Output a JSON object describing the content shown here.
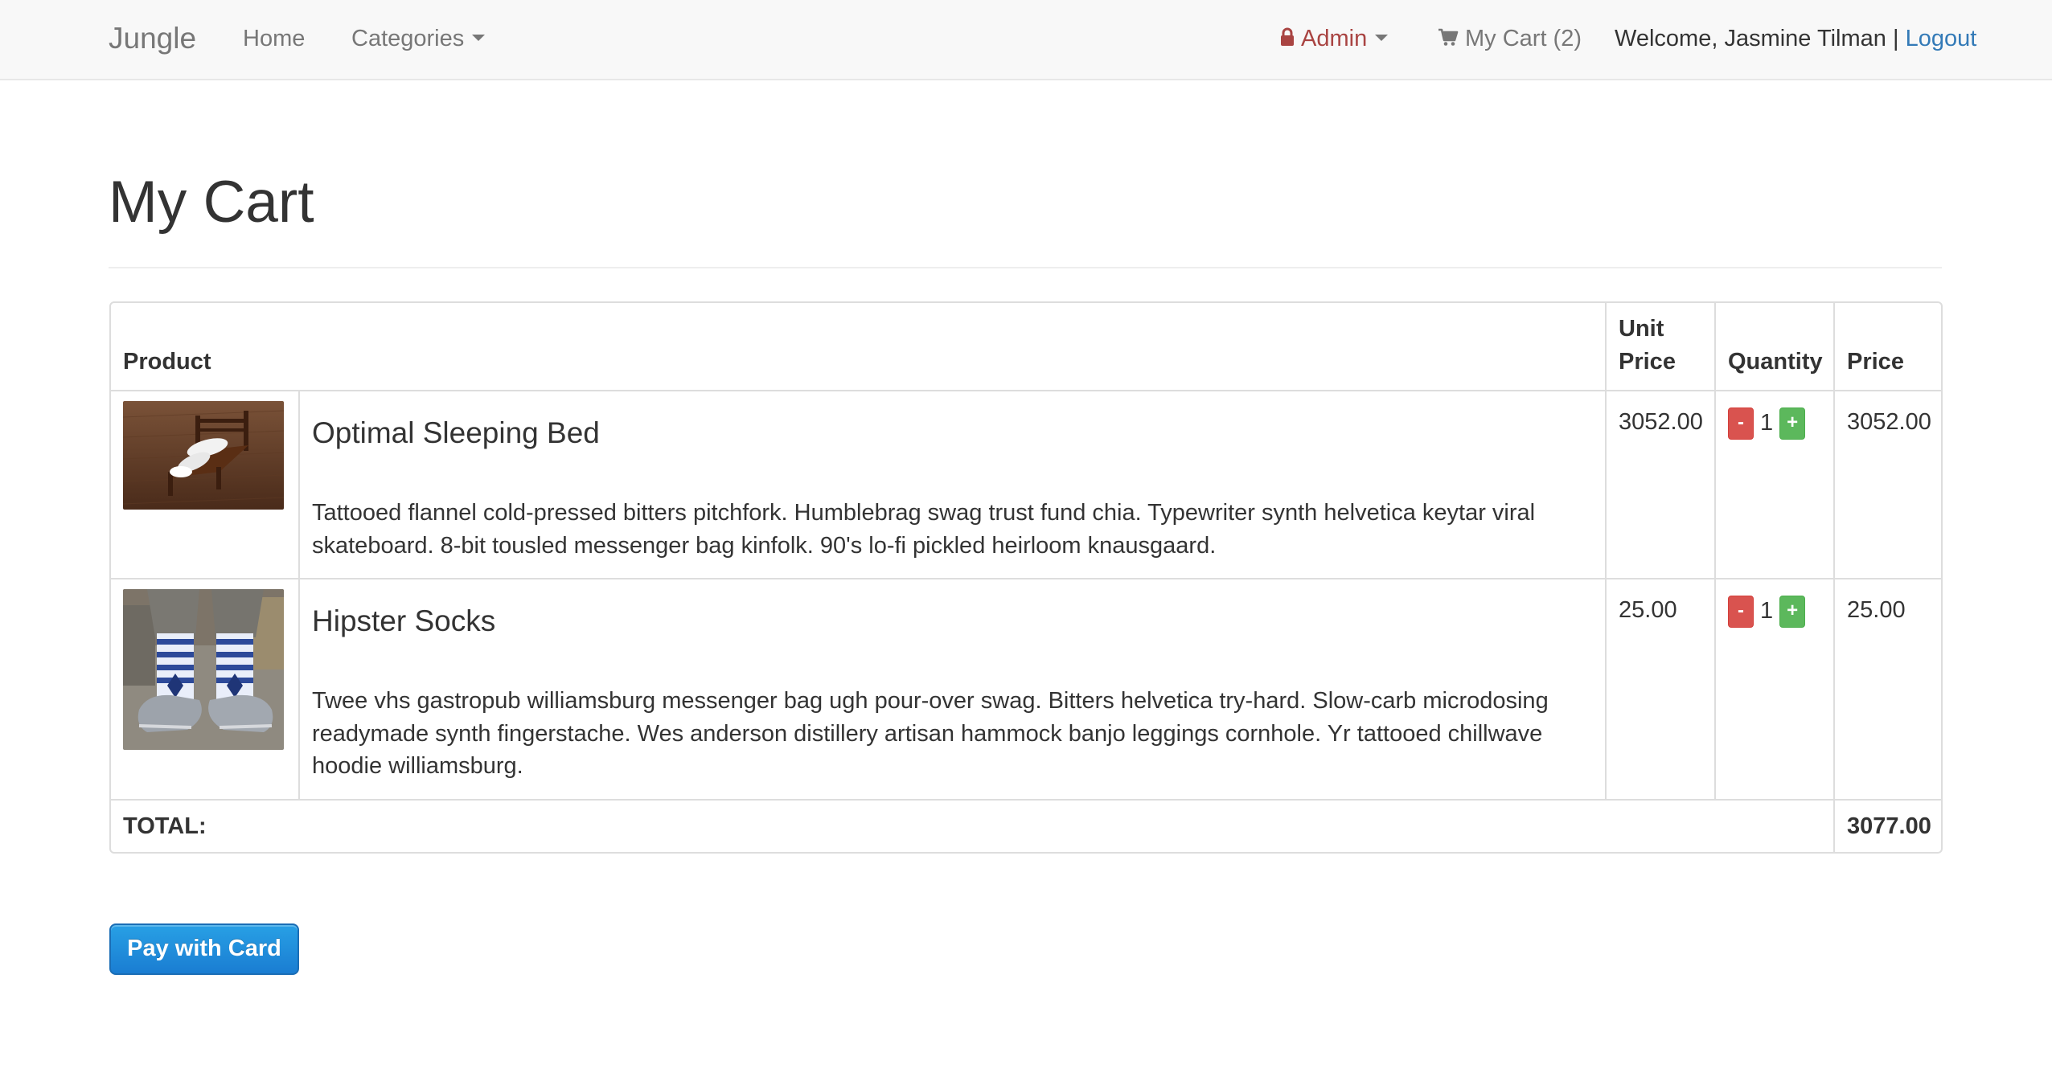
{
  "navbar": {
    "brand": "Jungle",
    "home": "Home",
    "categories": "Categories",
    "admin": "Admin",
    "cart": "My Cart (2)",
    "welcome": "Welcome, Jasmine Tilman",
    "separator": " | ",
    "logout": "Logout"
  },
  "icons": {
    "lock": "lock-icon",
    "cart": "shopping-cart-icon",
    "caret": "caret-down-icon"
  },
  "colors": {
    "admin": "#a94442",
    "link": "#337ab7",
    "qty_minus": "#d9534f",
    "qty_plus": "#5cb85c",
    "pay_button": "#1a7dd2"
  },
  "page": {
    "title": "My Cart"
  },
  "table": {
    "headers": {
      "product": "Product",
      "unit_price_1": "Unit",
      "unit_price_2": "Price",
      "quantity": "Quantity",
      "price": "Price"
    },
    "items": [
      {
        "name": "Optimal Sleeping Bed",
        "description": "Tattooed flannel cold-pressed bitters pitchfork. Humblebrag swag trust fund chia. Typewriter synth helvetica keytar viral skateboard. 8-bit tousled messenger bag kinfolk. 90's lo-fi pickled heirloom knausgaard.",
        "unit_price": "3052.00",
        "quantity": "1",
        "price": "3052.00",
        "minus": "-",
        "plus": "+"
      },
      {
        "name": "Hipster Socks",
        "description": "Twee vhs gastropub williamsburg messenger bag ugh pour-over swag. Bitters helvetica try-hard. Slow-carb microdosing readymade synth fingerstache. Wes anderson distillery artisan hammock banjo leggings cornhole. Yr tattooed chillwave hoodie williamsburg.",
        "unit_price": "25.00",
        "quantity": "1",
        "price": "25.00",
        "minus": "-",
        "plus": "+"
      }
    ],
    "total_label": "TOTAL:",
    "total_value": "3077.00"
  },
  "actions": {
    "pay": "Pay with Card"
  }
}
